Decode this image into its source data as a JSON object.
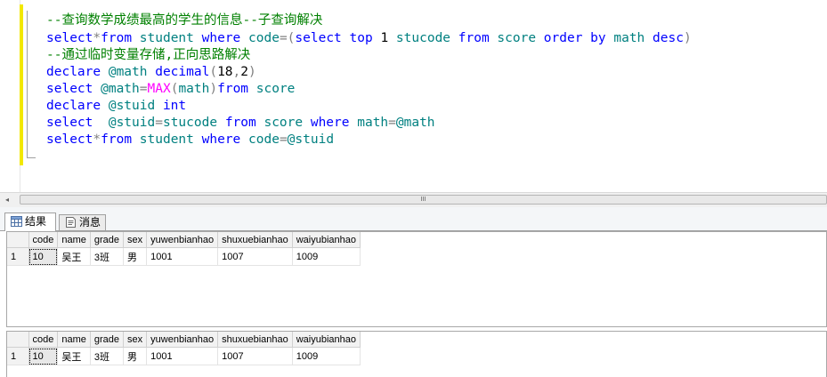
{
  "editor": {
    "lines": [
      [
        {
          "t": "--查询数学成绩最高的学生的信息--子查询解决",
          "c": "cm"
        }
      ],
      [
        {
          "t": "select",
          "c": "kw"
        },
        {
          "t": "*",
          "c": "op"
        },
        {
          "t": "from",
          "c": "kw"
        },
        {
          "t": " student ",
          "c": "id"
        },
        {
          "t": "where",
          "c": "kw"
        },
        {
          "t": " code",
          "c": "id"
        },
        {
          "t": "=(",
          "c": "op"
        },
        {
          "t": "select",
          "c": "kw"
        },
        {
          "t": " top ",
          "c": "kw"
        },
        {
          "t": "1",
          "c": "plain"
        },
        {
          "t": " stucode ",
          "c": "id"
        },
        {
          "t": "from",
          "c": "kw"
        },
        {
          "t": " score ",
          "c": "id"
        },
        {
          "t": "order by",
          "c": "kw"
        },
        {
          "t": " math ",
          "c": "id"
        },
        {
          "t": "desc",
          "c": "kw"
        },
        {
          "t": ")",
          "c": "op"
        }
      ],
      [
        {
          "t": "--通过临时变量存储,正向思路解决",
          "c": "cm"
        }
      ],
      [
        {
          "t": "declare",
          "c": "kw"
        },
        {
          "t": " @math ",
          "c": "id"
        },
        {
          "t": "decimal",
          "c": "kw"
        },
        {
          "t": "(",
          "c": "op"
        },
        {
          "t": "18",
          "c": "plain"
        },
        {
          "t": ",",
          "c": "op"
        },
        {
          "t": "2",
          "c": "plain"
        },
        {
          "t": ")",
          "c": "op"
        }
      ],
      [
        {
          "t": "select",
          "c": "kw"
        },
        {
          "t": " @math",
          "c": "id"
        },
        {
          "t": "=",
          "c": "op"
        },
        {
          "t": "MAX",
          "c": "fn"
        },
        {
          "t": "(",
          "c": "op"
        },
        {
          "t": "math",
          "c": "id"
        },
        {
          "t": ")",
          "c": "op"
        },
        {
          "t": "from",
          "c": "kw"
        },
        {
          "t": " score",
          "c": "id"
        }
      ],
      [
        {
          "t": "declare",
          "c": "kw"
        },
        {
          "t": " @stuid ",
          "c": "id"
        },
        {
          "t": "int",
          "c": "kw"
        }
      ],
      [
        {
          "t": "select",
          "c": "kw"
        },
        {
          "t": "  @stuid",
          "c": "id"
        },
        {
          "t": "=",
          "c": "op"
        },
        {
          "t": "stucode ",
          "c": "id"
        },
        {
          "t": "from",
          "c": "kw"
        },
        {
          "t": " score ",
          "c": "id"
        },
        {
          "t": "where",
          "c": "kw"
        },
        {
          "t": " math",
          "c": "id"
        },
        {
          "t": "=",
          "c": "op"
        },
        {
          "t": "@math",
          "c": "id"
        }
      ],
      [
        {
          "t": "select",
          "c": "kw"
        },
        {
          "t": "*",
          "c": "op"
        },
        {
          "t": "from",
          "c": "kw"
        },
        {
          "t": " student ",
          "c": "id"
        },
        {
          "t": "where",
          "c": "kw"
        },
        {
          "t": " code",
          "c": "id"
        },
        {
          "t": "=",
          "c": "op"
        },
        {
          "t": "@stuid",
          "c": "id"
        }
      ]
    ]
  },
  "scrollbar": {
    "left_arrow": "◂",
    "grip": "III"
  },
  "tabs": {
    "results": "结果",
    "messages": "消息"
  },
  "grid1": {
    "columns": [
      "code",
      "name",
      "grade",
      "sex",
      "yuwenbianhao",
      "shuxuebianhao",
      "waiyubianhao"
    ],
    "rows": [
      {
        "num": "1",
        "cells": [
          "10",
          "吴王",
          "3班",
          "男",
          "1001",
          "1007",
          "1009"
        ]
      }
    ]
  },
  "grid2": {
    "columns": [
      "code",
      "name",
      "grade",
      "sex",
      "yuwenbianhao",
      "shuxuebianhao",
      "waiyubianhao"
    ],
    "rows": [
      {
        "num": "1",
        "cells": [
          "10",
          "吴王",
          "3班",
          "男",
          "1001",
          "1007",
          "1009"
        ]
      }
    ]
  },
  "colors": {
    "keyword": "#0000ff",
    "identifier": "#008080",
    "comment": "#008000",
    "function": "#ff00ff",
    "change_bar": "#f2e800"
  }
}
